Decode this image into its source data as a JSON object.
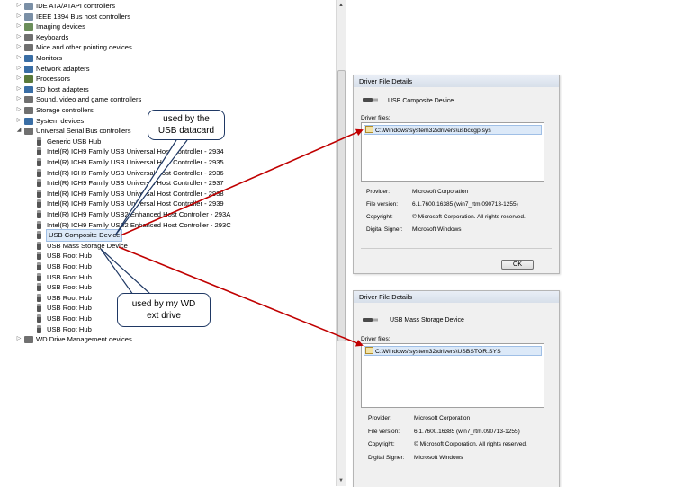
{
  "tree": {
    "items": [
      {
        "label": "IDE ATA/ATAPI controllers",
        "level": 0,
        "expander": "▷",
        "icon": "ide-controller-icon",
        "color": "#7a8fa6"
      },
      {
        "label": "IEEE 1394 Bus host controllers",
        "level": 0,
        "expander": "▷",
        "icon": "firewire-controller-icon",
        "color": "#7a8fa6"
      },
      {
        "label": "Imaging devices",
        "level": 0,
        "expander": "▷",
        "icon": "camera-icon",
        "color": "#6b8e5a"
      },
      {
        "label": "Keyboards",
        "level": 0,
        "expander": "▷",
        "icon": "keyboard-icon",
        "color": "#707070"
      },
      {
        "label": "Mice and other pointing devices",
        "level": 0,
        "expander": "▷",
        "icon": "mouse-icon",
        "color": "#707070"
      },
      {
        "label": "Monitors",
        "level": 0,
        "expander": "▷",
        "icon": "monitor-icon",
        "color": "#3a6ea5"
      },
      {
        "label": "Network adapters",
        "level": 0,
        "expander": "▷",
        "icon": "network-adapter-icon",
        "color": "#3a6ea5"
      },
      {
        "label": "Processors",
        "level": 0,
        "expander": "▷",
        "icon": "processor-icon",
        "color": "#5a7a3a"
      },
      {
        "label": "SD host adapters",
        "level": 0,
        "expander": "▷",
        "icon": "sd-card-icon",
        "color": "#3a6ea5"
      },
      {
        "label": "Sound, video and game controllers",
        "level": 0,
        "expander": "▷",
        "icon": "speaker-icon",
        "color": "#707070"
      },
      {
        "label": "Storage controllers",
        "level": 0,
        "expander": "▷",
        "icon": "storage-controller-icon",
        "color": "#707070"
      },
      {
        "label": "System devices",
        "level": 0,
        "expander": "▷",
        "icon": "system-device-icon",
        "color": "#3a6ea5"
      },
      {
        "label": "Universal Serial Bus controllers",
        "level": 0,
        "expander": "◢",
        "icon": "usb-controller-icon",
        "color": "#707070"
      },
      {
        "label": "Generic USB Hub",
        "level": 1,
        "icon": "usb-plug-icon",
        "color": "#666666"
      },
      {
        "label": "Intel(R) ICH9 Family USB Universal Host Controller - 2934",
        "level": 1,
        "icon": "usb-plug-icon",
        "color": "#666666"
      },
      {
        "label": "Intel(R) ICH9 Family USB Universal Host Controller - 2935",
        "level": 1,
        "icon": "usb-plug-icon",
        "color": "#666666"
      },
      {
        "label": "Intel(R) ICH9 Family USB Universal Host Controller - 2936",
        "level": 1,
        "icon": "usb-plug-icon",
        "color": "#666666"
      },
      {
        "label": "Intel(R) ICH9 Family USB Universal Host Controller - 2937",
        "level": 1,
        "icon": "usb-plug-icon",
        "color": "#666666"
      },
      {
        "label": "Intel(R) ICH9 Family USB Universal Host Controller - 2938",
        "level": 1,
        "icon": "usb-plug-icon",
        "color": "#666666"
      },
      {
        "label": "Intel(R) ICH9 Family USB Universal Host Controller - 2939",
        "level": 1,
        "icon": "usb-plug-icon",
        "color": "#666666"
      },
      {
        "label": "Intel(R) ICH9 Family USB2 Enhanced Host Controller - 293A",
        "level": 1,
        "icon": "usb-plug-icon",
        "color": "#666666"
      },
      {
        "label": "Intel(R) ICH9 Family USB2 Enhanced Host Controller - 293C",
        "level": 1,
        "icon": "usb-plug-icon",
        "color": "#666666"
      },
      {
        "label": "USB Composite Device",
        "level": 1,
        "icon": "usb-plug-icon",
        "color": "#666666",
        "selected": true
      },
      {
        "label": "USB Mass Storage Device",
        "level": 1,
        "icon": "usb-plug-icon",
        "color": "#666666"
      },
      {
        "label": "USB Root Hub",
        "level": 1,
        "icon": "usb-plug-icon",
        "color": "#666666"
      },
      {
        "label": "USB Root Hub",
        "level": 1,
        "icon": "usb-plug-icon",
        "color": "#666666"
      },
      {
        "label": "USB Root Hub",
        "level": 1,
        "icon": "usb-plug-icon",
        "color": "#666666"
      },
      {
        "label": "USB Root Hub",
        "level": 1,
        "icon": "usb-plug-icon",
        "color": "#666666"
      },
      {
        "label": "USB Root Hub",
        "level": 1,
        "icon": "usb-plug-icon",
        "color": "#666666"
      },
      {
        "label": "USB Root Hub",
        "level": 1,
        "icon": "usb-plug-icon",
        "color": "#666666"
      },
      {
        "label": "USB Root Hub",
        "level": 1,
        "icon": "usb-plug-icon",
        "color": "#666666"
      },
      {
        "label": "USB Root Hub",
        "level": 1,
        "icon": "usb-plug-icon",
        "color": "#666666"
      },
      {
        "label": "WD Drive Management devices",
        "level": 0,
        "expander": "▷",
        "icon": "wd-device-icon",
        "color": "#707070"
      }
    ]
  },
  "callouts": {
    "datacard": {
      "line1": "used by the",
      "line2": "USB datacard"
    },
    "wd": {
      "line1": "used by my WD",
      "line2": "ext drive"
    }
  },
  "dialog1": {
    "title": "Driver File Details",
    "device_name": "USB Composite Device",
    "files_label": "Driver files:",
    "file": "C:\\Windows\\system32\\drivers\\usbccgp.sys",
    "provider_label": "Provider:",
    "provider": "Microsoft Corporation",
    "version_label": "File version:",
    "version": "6.1.7600.16385 (win7_rtm.090713-1255)",
    "copyright_label": "Copyright:",
    "copyright": "© Microsoft Corporation. All rights reserved.",
    "signer_label": "Digital Signer:",
    "signer": "Microsoft Windows",
    "ok_label": "OK"
  },
  "dialog2": {
    "title": "Driver File Details",
    "device_name": "USB Mass Storage Device",
    "files_label": "Driver files:",
    "file": "C:\\Windows\\system32\\drivers\\USBSTOR.SYS",
    "provider_label": "Provider:",
    "provider": "Microsoft Corporation",
    "version_label": "File version:",
    "version": "6.1.7600.16385 (win7_rtm.090713-1255)",
    "copyright_label": "Copyright:",
    "copyright": "© Microsoft Corporation. All rights reserved.",
    "signer_label": "Digital Signer:",
    "signer": "Microsoft Windows"
  },
  "colors": {
    "arrow": "#c00000",
    "callout_border": "#1f3864",
    "selection": "#dce9f8"
  }
}
